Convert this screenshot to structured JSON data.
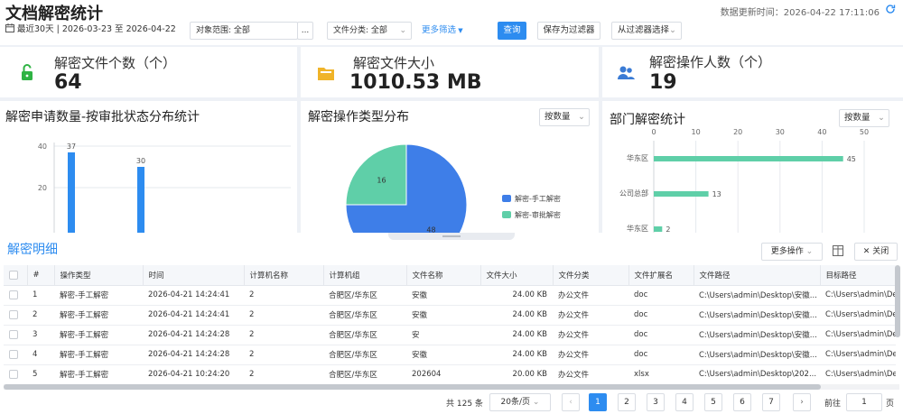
{
  "header": {
    "title": "文档解密统计",
    "update_label": "数据更新时间：2026-04-22 17:11:06",
    "date_range": "最近30天 | 2026-03-23 至 2026-04-22",
    "scope_label": "对象范围: 全部",
    "scope_more": "...",
    "category_label": "文件分类: 全部",
    "more_filter": "更多筛选",
    "query": "查询",
    "save_filter": "保存为过滤器",
    "choose_filter": "从过滤器选择"
  },
  "kpis": [
    {
      "label": "解密文件个数（个）",
      "value": "64",
      "icon": "unlock-icon",
      "color": "#2fb344",
      "bg": "#e3f5e8"
    },
    {
      "label": "解密文件大小",
      "value": "1010.53 MB",
      "icon": "folder-icon",
      "color": "#f0b429",
      "bg": "#fdf3d8"
    },
    {
      "label": "解密操作人数（个）",
      "value": "19",
      "icon": "users-icon",
      "color": "#3a7bd5",
      "bg": "#e2ecfb"
    }
  ],
  "panels": {
    "status": {
      "title": "解密申请数量-按审批状态分布统计"
    },
    "optype": {
      "title": "解密操作类型分布",
      "select": "按数量"
    },
    "dept": {
      "title": "部门解密统计",
      "select": "按数量"
    }
  },
  "chart_data": [
    {
      "type": "bar",
      "y": [
        37,
        30
      ],
      "ylim": [
        0,
        40
      ],
      "yticks": [
        20,
        40
      ],
      "grid": true,
      "colors": [
        "#2d8cf0"
      ]
    },
    {
      "type": "pie",
      "series": [
        {
          "name": "解密-手工解密",
          "value": 48,
          "color": "#3e7ee8"
        },
        {
          "name": "解密-审批解密",
          "value": 16,
          "color": "#5fcfa8"
        }
      ],
      "legend": "right"
    },
    {
      "type": "bar",
      "orientation": "horizontal",
      "categories": [
        "华东区",
        "公司总部",
        "华东区"
      ],
      "values": [
        45,
        13,
        2
      ],
      "xlim": [
        0,
        50
      ],
      "xticks": [
        0,
        10,
        20,
        30,
        40,
        50
      ],
      "grid": true,
      "colors": [
        "#5fcfa8"
      ]
    }
  ],
  "detail": {
    "title": "解密明细",
    "more_ops": "更多操作",
    "close": "关闭",
    "columns": [
      "#",
      "操作类型",
      "时间",
      "计算机名称",
      "计算机组",
      "文件名称",
      "文件大小",
      "文件分类",
      "文件扩展名",
      "文件路径",
      "目标路径"
    ],
    "rows": [
      [
        "1",
        "解密-手工解密",
        "2026-04-21 14:24:41",
        "2",
        "合肥区/华东区",
        "安徽",
        "24.00 KB",
        "办公文件",
        "doc",
        "C:\\Users\\admin\\Desktop\\安徽...",
        "C:\\Users\\admin\\De"
      ],
      [
        "2",
        "解密-手工解密",
        "2026-04-21 14:24:41",
        "2",
        "合肥区/华东区",
        "安徽",
        "24.00 KB",
        "办公文件",
        "doc",
        "C:\\Users\\admin\\Desktop\\安徽...",
        "C:\\Users\\admin\\De"
      ],
      [
        "3",
        "解密-手工解密",
        "2026-04-21 14:24:28",
        "2",
        "合肥区/华东区",
        "安",
        "24.00 KB",
        "办公文件",
        "doc",
        "C:\\Users\\admin\\Desktop\\安徽...",
        "C:\\Users\\admin\\De"
      ],
      [
        "4",
        "解密-手工解密",
        "2026-04-21 14:24:28",
        "2",
        "合肥区/华东区",
        "安徽",
        "24.00 KB",
        "办公文件",
        "doc",
        "C:\\Users\\admin\\Desktop\\安徽...",
        "C:\\Users\\admin\\De"
      ],
      [
        "5",
        "解密-手工解密",
        "2026-04-21 10:24:20",
        "2",
        "合肥区/华东区",
        "202604",
        "20.00 KB",
        "办公文件",
        "xlsx",
        "C:\\Users\\admin\\Desktop\\202...",
        "C:\\Users\\admin\\De"
      ]
    ]
  },
  "pagination": {
    "total": "共 125 条",
    "page_size": "20条/页",
    "pages": [
      "1",
      "2",
      "3",
      "4",
      "5",
      "6",
      "7"
    ],
    "current": 1,
    "goto_label": "前往",
    "goto_value": "1",
    "page_unit": "页"
  }
}
